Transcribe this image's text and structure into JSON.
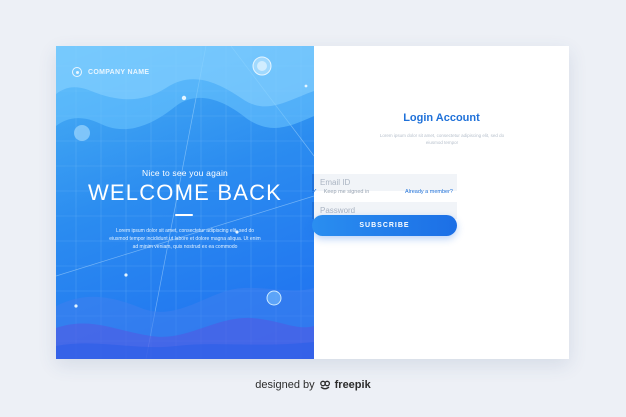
{
  "left_panel": {
    "company_name": "COMPANY NAME",
    "greeting": "Nice to see you again",
    "headline": "WELCOME BACK",
    "body_text": "Lorem ipsum dolor sit amet, consectetur adipiscing elit, sed do eiusmod tempor incididunt ut labore et dolore magna aliqua. Ut enim ad minim veniam, quis nostrud ex ea commodo"
  },
  "login": {
    "title": "Login Account",
    "subtitle": "Lorem ipsum dolor sit amet, consectetur adipiscing elit, sed do eiusmod tempor",
    "email_placeholder": "Email ID",
    "password_placeholder": "Password",
    "keep_signed_in": "Keep me signed in",
    "already_member": "Already a member?",
    "subscribe_label": "SUBSCRIBE"
  },
  "footer": {
    "designed_by": "designed by",
    "brand": "freepik"
  },
  "colors": {
    "accent": "#1f71d9",
    "panel_dark": "#1d6df0",
    "panel_light": "#4cb3f5",
    "page_bg": "#edf0f6"
  }
}
